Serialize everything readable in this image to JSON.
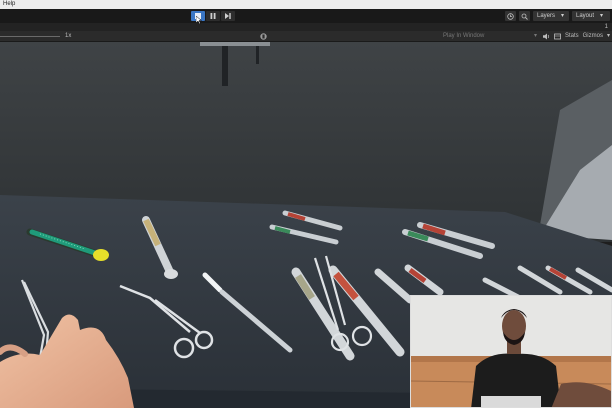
{
  "menubar": {
    "help_label": "Help"
  },
  "toolbar": {
    "layers_label": "Layers",
    "layout_label": "Layout",
    "dropdown_caret": "▾",
    "play_icon": "play-icon",
    "pause_icon": "pause-icon",
    "step_icon": "step-icon",
    "accent_color": "#3a76c4"
  },
  "tabstrip": {
    "count": "1"
  },
  "game_view": {
    "time_scale": "1x",
    "play_mode_label": "Play In Window",
    "stats_label": "Stats",
    "gizmos_label": "Gizmos",
    "dropdown_caret": "▾"
  },
  "scene": {
    "description_items": [
      "green-handle-brush",
      "small-syringe",
      "forceps",
      "hand",
      "curved-scissors",
      "scalpel",
      "syringes",
      "scissors",
      "surgical-tray",
      "overhead-lamp"
    ],
    "tray_color": "#323940",
    "wall_color": "#363a3c"
  },
  "webcam": {
    "background_color": "#e6e6e4",
    "shirt_color": "#1c1c1c",
    "sofa_color": "#c88a5a"
  }
}
